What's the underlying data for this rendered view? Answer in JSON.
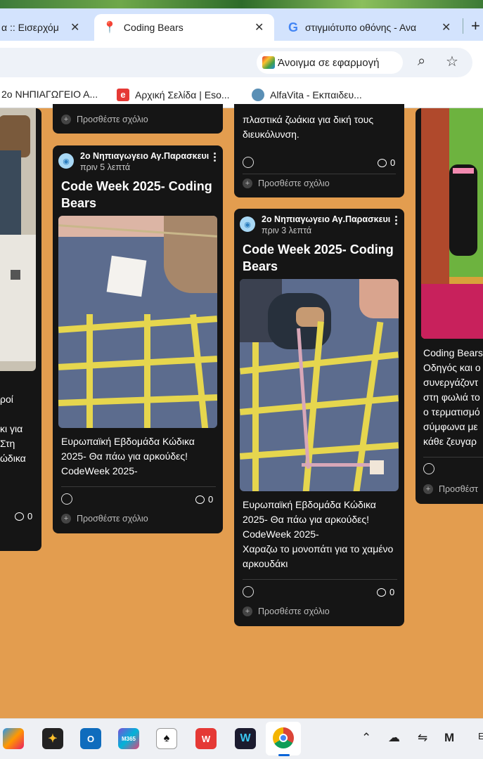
{
  "browser": {
    "tabs": [
      {
        "label": "α :: Εισερχόμ",
        "active": false
      },
      {
        "label": "Coding Bears",
        "active": true
      },
      {
        "label": "στιγμιότυπο οθόνης - Ανα",
        "active": false
      }
    ],
    "new_tab_symbol": "+",
    "open_in_app_label": "Άνοιγμα σε εφαρμογή",
    "bookmarks": [
      {
        "label": "2ο ΝΗΠΙΑΓΩΓΕΙΟ Α..."
      },
      {
        "label": "Αρχική Σελίδα | Eso..."
      },
      {
        "label": "AlfaVita - Εκπαιδευ..."
      }
    ]
  },
  "cards": {
    "top_left_add": "Προσθέστε σχόλιο",
    "top_middle": {
      "body": "πλαστικά ζωάκια για δική τους διευκόλυνση.",
      "comment_count": "0",
      "add": "Προσθέστε σχόλιο"
    },
    "post_a": {
      "author": "2ο Νηπιαγωγειο Αγ.Παρασκευι",
      "time": "πριν 5 λεπτά",
      "title": "Code Week 2025- Coding Bears",
      "body": "Ευρωπαϊκή Εβδομάδα Κώδικα 2025- Θα πάω για αρκούδες! CodeWeek 2025-",
      "comment_count": "0",
      "add": "Προσθέστε σχόλιο"
    },
    "post_b": {
      "author": "2ο Νηπιαγωγειο Αγ.Παρασκευι",
      "time": "πριν 3 λεπτά",
      "title": "Code Week 2025- Coding Bears",
      "body_line1": "Ευρωπαϊκή Εβδομάδα Κώδικα 2025- Θα πάω για αρκούδες! CodeWeek 2025-",
      "body_line2": "Χαραζω το μονοπάτι για το χαμένο αρκουδάκι",
      "comment_count": "0",
      "add": "Προσθέστε σχόλιο"
    },
    "left_partial": {
      "lines": [
        "ροί",
        "",
        "κι για",
        "Στη",
        "ώδικα"
      ],
      "comment_count": "0"
    },
    "right_partial": {
      "lines": [
        "Coding Bears",
        "Οδηγός και ο",
        "συνεργάζοντ",
        "στη φωλιά το",
        "ο τερματισμό",
        "σύμφωνα με",
        "κάθε ζευγαρ"
      ],
      "add": "Προσθέστ"
    }
  },
  "taskbar": {
    "apps": [
      "photos",
      "spark",
      "outlook",
      "m365",
      "solitaire",
      "wps",
      "webex",
      "chrome"
    ],
    "m365_label": "M365",
    "wps_label": "W"
  }
}
